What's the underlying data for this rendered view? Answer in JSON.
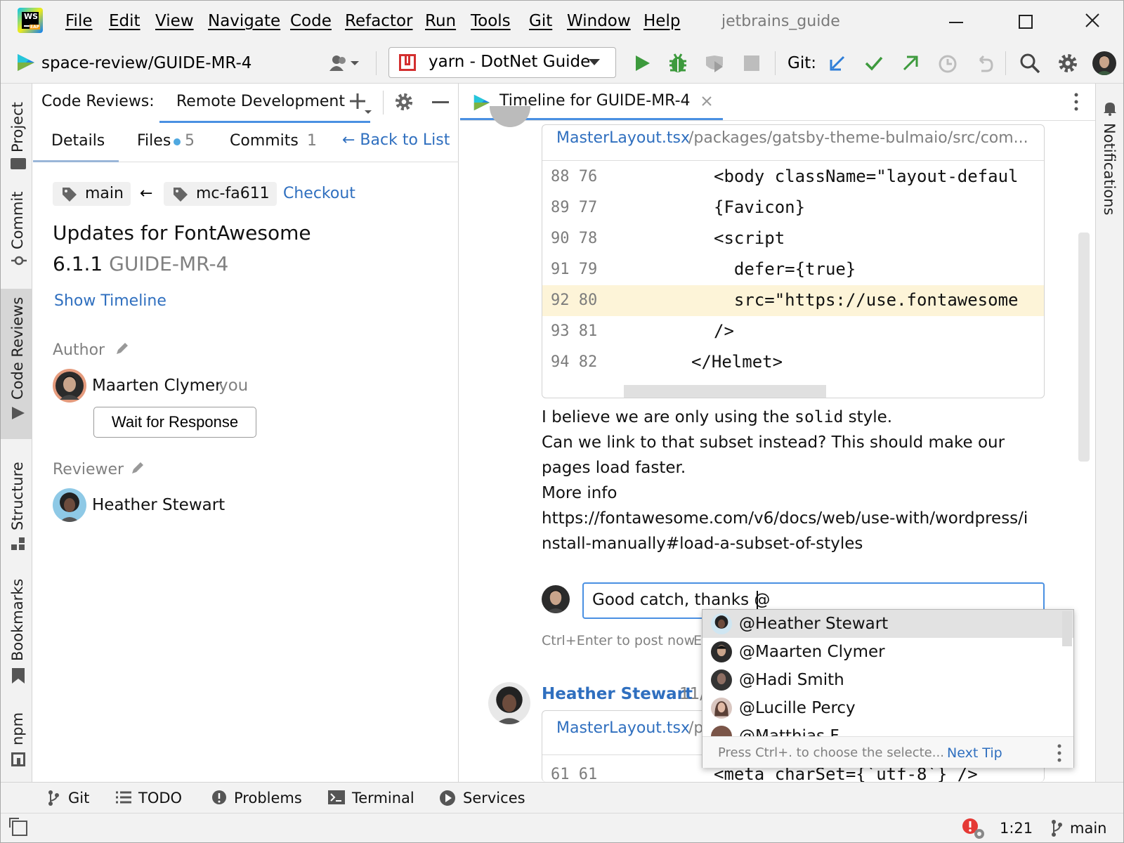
{
  "menu": {
    "logo_text": "WS",
    "logo_sub": "EAP",
    "items": [
      "File",
      "Edit",
      "View",
      "Navigate",
      "Code",
      "Refactor",
      "Run",
      "Tools",
      "Git",
      "Window",
      "Help"
    ],
    "app_name": "jetbrains_guide"
  },
  "toolbar": {
    "project": "space-review/GUIDE-MR-4",
    "run_config": "yarn - DotNet Guide",
    "git_label": "Git:"
  },
  "left_strip": {
    "tabs": [
      "Project",
      "Commit",
      "Code Reviews",
      "Structure",
      "Bookmarks",
      "npm"
    ]
  },
  "right_strip": {
    "notifications": "Notifications"
  },
  "review_panel": {
    "title": "Code Reviews:",
    "tab": "Remote Development",
    "sub_tabs": {
      "details": "Details",
      "files": "Files",
      "files_count": "5",
      "commits": "Commits",
      "commits_count": "1",
      "back": "← Back to List"
    },
    "branch_target": "main",
    "arrow": "←",
    "branch_source": "mc-fa611",
    "checkout": "Checkout",
    "title_line1": "Updates for FontAwesome",
    "title_line2": "6.1.1",
    "review_id": "GUIDE-MR-4",
    "show_timeline": "Show Timeline",
    "author_label": "Author",
    "author_name": "Maarten Clymer",
    "author_you": "you",
    "wait_button": "Wait for Response",
    "reviewer_label": "Reviewer",
    "reviewer_name": "Heather Stewart"
  },
  "editor": {
    "tab_title": "Timeline for GUIDE-MR-4",
    "file_name": "MasterLayout.tsx",
    "file_path": "/packages/gatsby-theme-bulmaio/src/com...",
    "code_lines": [
      {
        "num": "88 76",
        "text": "<body className=\"layout-defaul"
      },
      {
        "num": "89 77",
        "text": "{Favicon}"
      },
      {
        "num": "90 78",
        "text": "<script"
      },
      {
        "num": "91 79",
        "text": "  defer={true}"
      },
      {
        "num": "92 80",
        "text": "  src=\"https://use.fontawesome"
      },
      {
        "num": "93 81",
        "text": "/>"
      },
      {
        "num": "94 82",
        "text": "</Helmet>"
      }
    ],
    "comment": {
      "line1_a": "I believe we are only using the ",
      "line1_code": "solid",
      "line1_b": " style.",
      "line2": "Can we link to that subset instead? This should make our",
      "line3": "pages load faster.",
      "line4": "More info",
      "link1": "https://fontawesome.com/v6/docs/web/use-with/wordpress/i",
      "link2": "nstall-manually#load-a-subset-of-styles"
    },
    "reply_value": "Good catch, thanks @",
    "hint": "Ctrl+Enter to post now",
    "hint_cut": "E",
    "next_author": "Heather Stewart",
    "next_date": "11/",
    "next_file": "MasterLayout.tsx",
    "next_path": "/p",
    "next_code_num": "61 61",
    "next_code_text": "<meta charSet={`utf-8`} />"
  },
  "mention_popup": {
    "items": [
      "@Heather Stewart",
      "@Maarten Clymer",
      "@Hadi Smith",
      "@Lucille Percy",
      "@Matthias F"
    ],
    "footer_hint": "Press Ctrl+. to choose the selecte...",
    "next_tip": "Next Tip"
  },
  "bottom_tools": [
    "Git",
    "TODO",
    "Problems",
    "Terminal",
    "Services"
  ],
  "status": {
    "position": "1:21",
    "branch": "main"
  },
  "colors": {
    "accent": "#2f6fbf",
    "selection": "#fdf4d8",
    "run_green": "#3d9a3d"
  }
}
